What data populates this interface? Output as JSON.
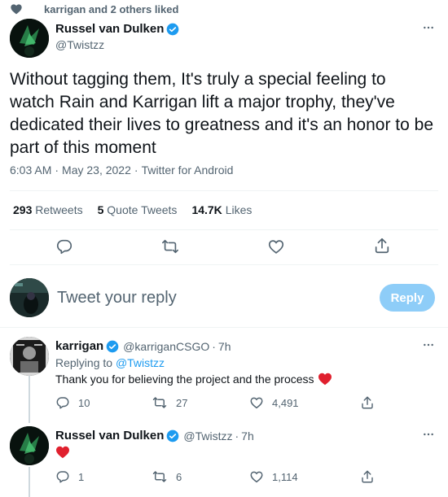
{
  "social_context": "karrigan and 2 others liked",
  "main_tweet": {
    "author_name": "Russel van Dulken",
    "author_handle": "@Twistzz",
    "text": "Without tagging them, It's truly a special feeling to watch Rain and Karrigan lift a major trophy, they've dedicated their lives to greatness and it's an honor to be part of this moment",
    "time": "6:03 AM",
    "date": "May 23, 2022",
    "source": "Twitter for Android",
    "sep": "·",
    "retweets_count": "293",
    "retweets_label": "Retweets",
    "quotes_count": "5",
    "quotes_label": "Quote Tweets",
    "likes_count": "14.7K",
    "likes_label": "Likes"
  },
  "reply_box": {
    "placeholder": "Tweet your reply",
    "button_label": "Reply"
  },
  "replies": [
    {
      "author_name": "karrigan",
      "author_handle": "@karriganCSGO",
      "time": "7h",
      "replying_to_label": "Replying to",
      "replying_to_handle": "@Twistzz",
      "text": "Thank you for believing the project and the process",
      "replies": "10",
      "retweets": "27",
      "likes": "4,491"
    },
    {
      "author_name": "Russel van Dulken",
      "author_handle": "@Twistzz",
      "time": "7h",
      "replies": "1",
      "retweets": "6",
      "likes": "1,114"
    }
  ],
  "icons": {
    "heart": "heart-icon",
    "reply": "reply-icon",
    "retweet": "retweet-icon",
    "like": "like-icon",
    "share": "share-icon",
    "verified": "verified-badge-icon",
    "more": "more-icon"
  },
  "colors": {
    "accent": "#1d9bf0",
    "reply_button_disabled": "#8ecdf8",
    "heart_red": "#f91880",
    "text": "#0f1419",
    "muted": "#536471"
  }
}
